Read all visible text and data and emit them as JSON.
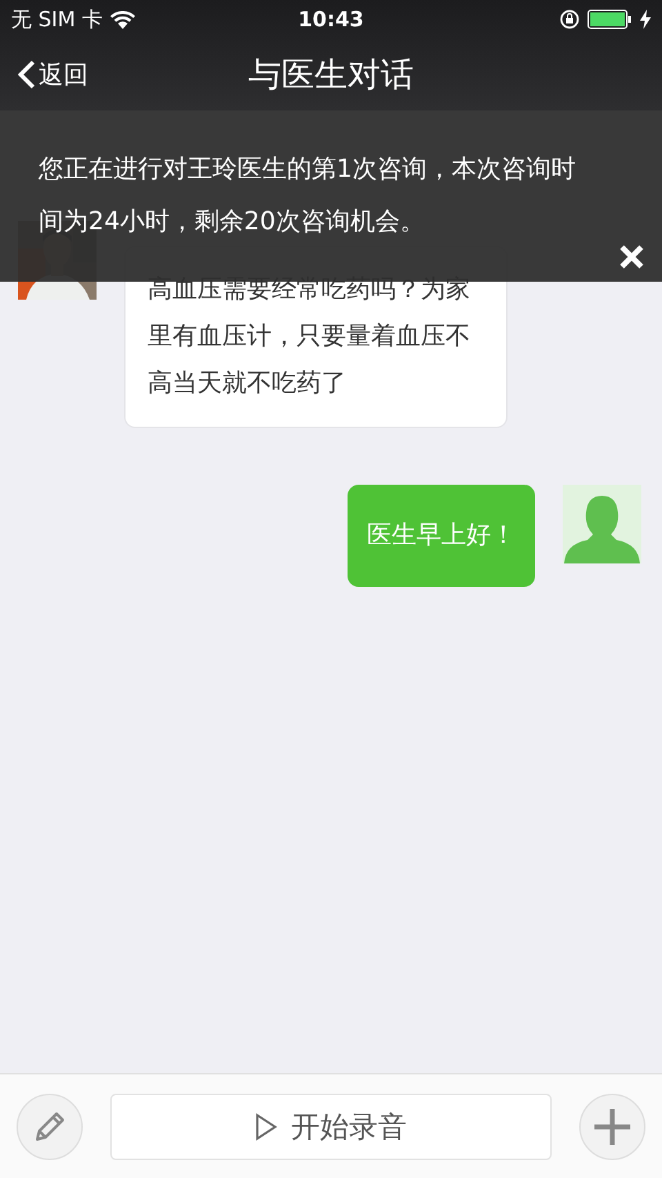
{
  "status_bar": {
    "carrier": "无 SIM 卡",
    "time": "10:43"
  },
  "nav": {
    "back": "返回",
    "title": "与医生对话"
  },
  "notice": {
    "text": "您正在进行对王玲医生的第1次咨询，本次咨询时间为24小时，剩余20次咨询机会。"
  },
  "messages": [
    {
      "kind": "incoming",
      "text": "高血压需要经常吃药吗？为家里有血压计，只要量着血压不高当天就不吃药了"
    },
    {
      "kind": "outgoing",
      "text": "医生早上好！"
    }
  ],
  "input_bar": {
    "record_label": "开始录音"
  }
}
